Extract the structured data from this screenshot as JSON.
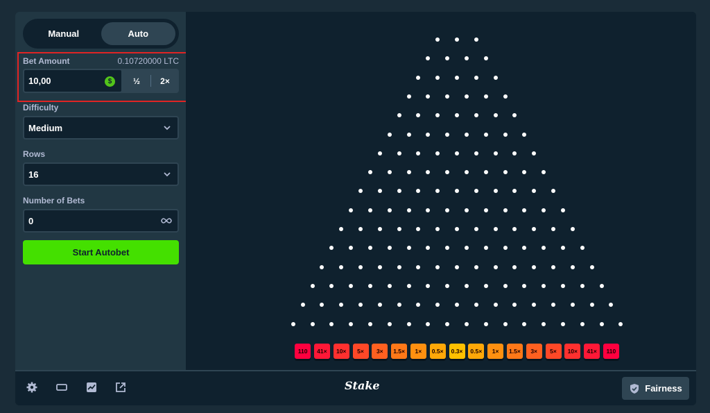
{
  "tabs": {
    "manual": "Manual",
    "auto": "Auto",
    "active": "auto"
  },
  "bet": {
    "label": "Bet Amount",
    "balance": "0.10720000 LTC",
    "value": "10,00",
    "currency_icon": "dollar-coin-icon",
    "half": "½",
    "double": "2×"
  },
  "difficulty": {
    "label": "Difficulty",
    "value": "Medium"
  },
  "rows": {
    "label": "Rows",
    "value": "16"
  },
  "num_bets": {
    "label": "Number of Bets",
    "value": "0",
    "icon": "infinity-icon"
  },
  "start_button": "Start Autobet",
  "board": {
    "peg_rows": 16,
    "multipliers": [
      {
        "label": "110",
        "color": "#ff003f"
      },
      {
        "label": "41×",
        "color": "#ff1837"
      },
      {
        "label": "10×",
        "color": "#ff302f"
      },
      {
        "label": "5×",
        "color": "#ff4827"
      },
      {
        "label": "3×",
        "color": "#ff6020"
      },
      {
        "label": "1.5×",
        "color": "#ff7818"
      },
      {
        "label": "1×",
        "color": "#ff9010"
      },
      {
        "label": "0.5×",
        "color": "#ffa808"
      },
      {
        "label": "0.3×",
        "color": "#ffc000"
      },
      {
        "label": "0.5×",
        "color": "#ffa808"
      },
      {
        "label": "1×",
        "color": "#ff9010"
      },
      {
        "label": "1.5×",
        "color": "#ff7818"
      },
      {
        "label": "3×",
        "color": "#ff6020"
      },
      {
        "label": "5×",
        "color": "#ff4827"
      },
      {
        "label": "10×",
        "color": "#ff302f"
      },
      {
        "label": "41×",
        "color": "#ff1837"
      },
      {
        "label": "110",
        "color": "#ff003f"
      }
    ]
  },
  "footer": {
    "icons": [
      "gear-icon",
      "theatre-mode-icon",
      "stats-icon",
      "popout-icon"
    ],
    "logo": "Stake",
    "fairness": "Fairness"
  },
  "colors": {
    "accent_green": "#44e000",
    "sidebar": "#213743",
    "background": "#0f212e"
  }
}
